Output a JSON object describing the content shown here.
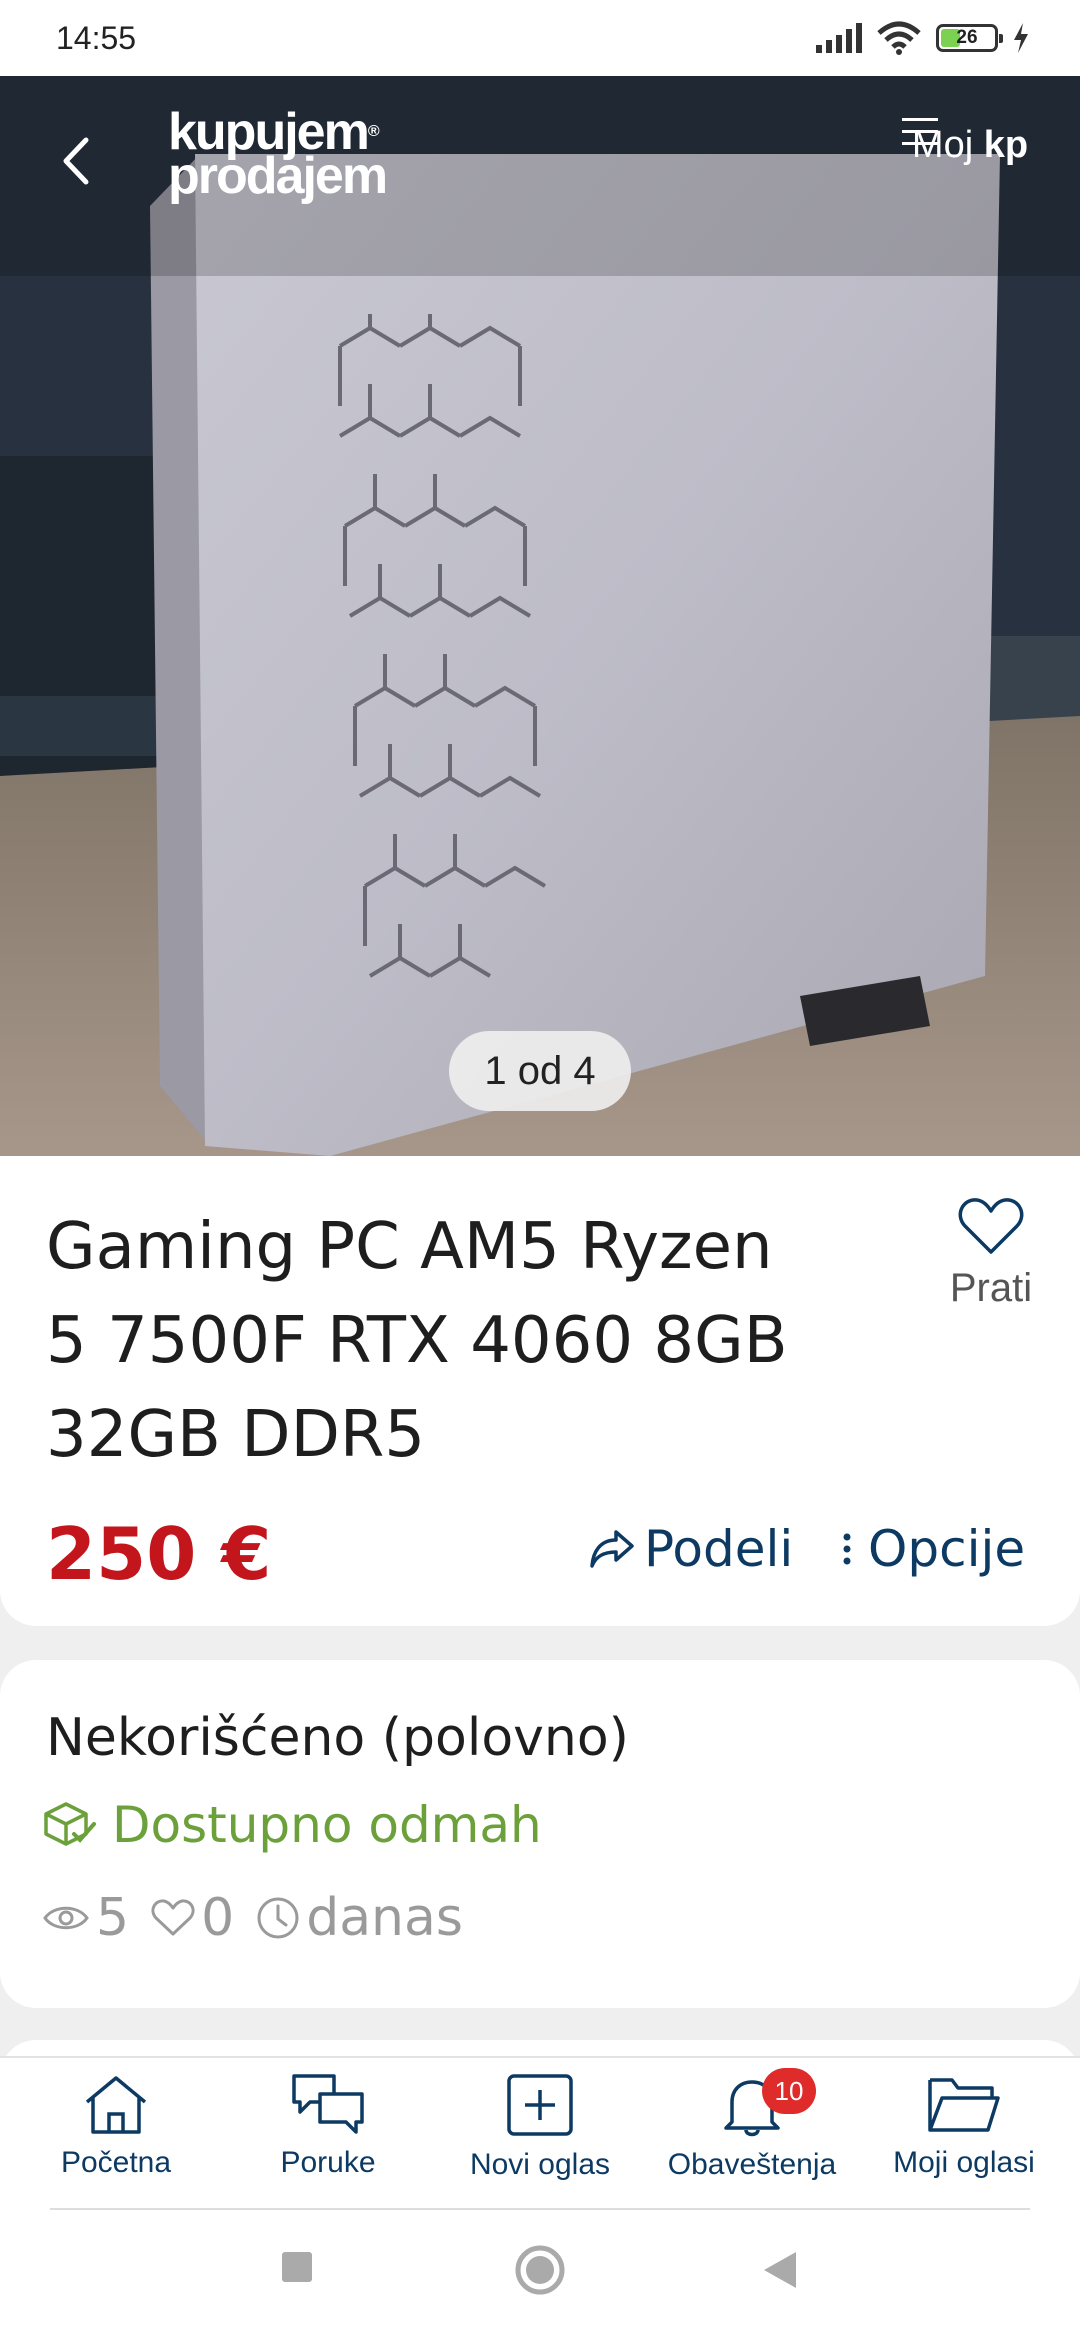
{
  "status_bar": {
    "time": "14:55",
    "battery_percent": "26",
    "icons": [
      "signal-icon",
      "wifi-icon",
      "battery-icon",
      "charging-icon"
    ]
  },
  "header": {
    "logo_line1": "kupujem",
    "logo_line2": "prodajem",
    "logo_mark": "®",
    "menu_label_prefix": "Moj",
    "menu_label_brand": "kp"
  },
  "gallery": {
    "counter": "1 od 4",
    "current_image": 1,
    "total_images": 4
  },
  "listing": {
    "title": "Gaming PC AM5 Ryzen 5 7500F RTX 4060 8GB 32GB DDR5",
    "price": "250 €",
    "follow_label": "Prati",
    "share_label": "Podeli",
    "options_label": "Opcije"
  },
  "info": {
    "condition": "Nekorišćeno (polovno)",
    "availability": "Dostupno odmah",
    "views": "5",
    "likes": "0",
    "posted": "danas"
  },
  "bottom_nav": {
    "items": [
      {
        "label": "Početna",
        "icon": "home-icon"
      },
      {
        "label": "Poruke",
        "icon": "messages-icon"
      },
      {
        "label": "Novi oglas",
        "icon": "add-listing-icon"
      },
      {
        "label": "Obaveštenja",
        "icon": "bell-icon",
        "badge": "10"
      },
      {
        "label": "Moji oglasi",
        "icon": "folder-icon"
      }
    ]
  },
  "colors": {
    "brand_navy": "#0c3a63",
    "price_red": "#c3161c",
    "available_green": "#6ba03a",
    "badge_red": "#e02b2b"
  }
}
